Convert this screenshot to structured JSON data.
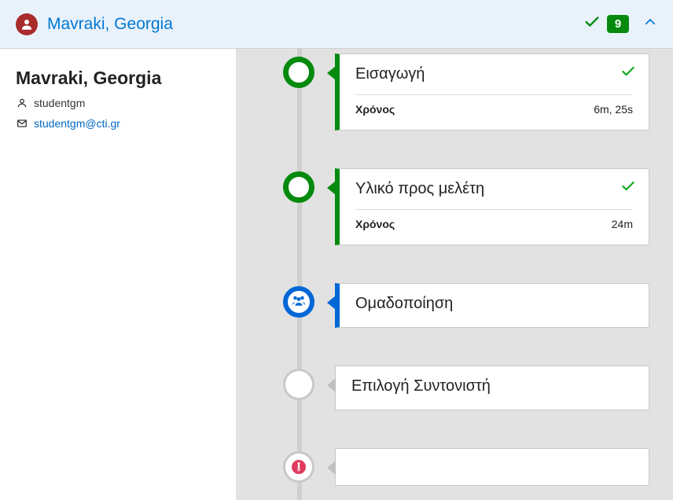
{
  "header": {
    "name": "Mavraki, Georgia",
    "badge": "9"
  },
  "profile": {
    "name": "Mavraki, Georgia",
    "username": "studentgm",
    "email": "studentgm@cti.gr"
  },
  "timeline": {
    "time_label": "Χρόνος",
    "steps": [
      {
        "title": "Εισαγωγή",
        "time": "6m, 25s",
        "status": "done"
      },
      {
        "title": "Υλικό προς μελέτη",
        "time": "24m",
        "status": "done"
      },
      {
        "title": "Ομαδοποίηση",
        "status": "active"
      },
      {
        "title": "Επιλογή Συντονιστή",
        "status": "pending"
      },
      {
        "title": "",
        "status": "pending-person"
      }
    ]
  }
}
